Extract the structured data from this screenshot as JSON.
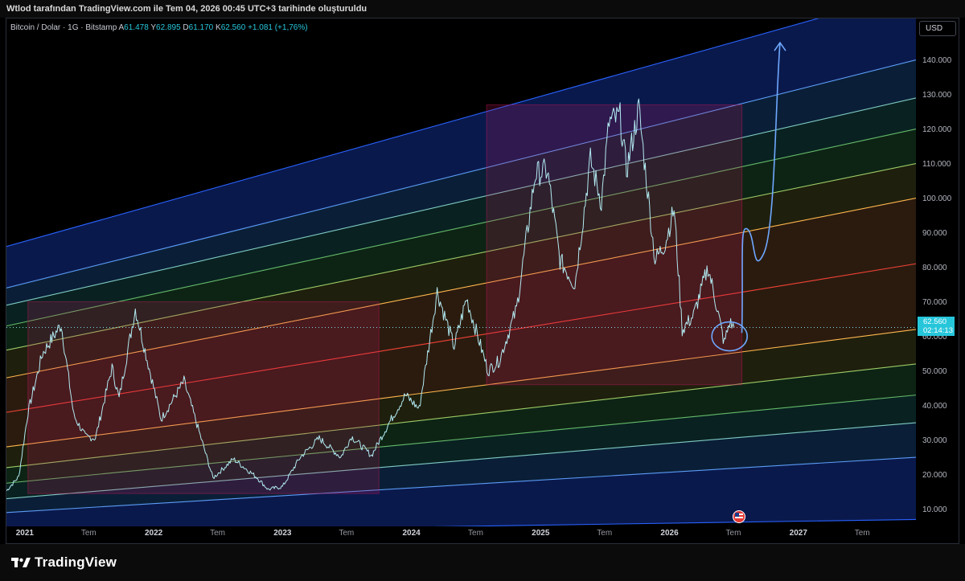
{
  "header": {
    "caption": "Wtlod tarafından TradingView.com ile Tem 04, 2026 00:45 UTC+3 tarihinde oluşturuldu"
  },
  "legend": {
    "symbol": "Bitcoin / Dolar · 1G · Bitstamp",
    "open_label": "A",
    "open": "61.478",
    "high_label": "Y",
    "high": "62.895",
    "low_label": "D",
    "low": "61.170",
    "close_label": "K",
    "close": "62.560",
    "change": "+1.081 (+1,76%)"
  },
  "currency": "USD",
  "price_tag": {
    "price": "62.560",
    "countdown": "02:14:13"
  },
  "brand": "TradingView",
  "colors": {
    "background": "#000000",
    "candle": "#b2ebf2",
    "accent": "#26c6da",
    "annotation": "#6ea8ff"
  },
  "chart_data": {
    "type": "candlestick",
    "x_axis": {
      "start": "2020-11-10",
      "end": "2027-11-30",
      "tick_labels": [
        {
          "date": "2021-01-01",
          "label": "2021"
        },
        {
          "date": "2021-07-01",
          "label": "Tem"
        },
        {
          "date": "2022-01-01",
          "label": "2022"
        },
        {
          "date": "2022-07-01",
          "label": "Tem"
        },
        {
          "date": "2023-01-01",
          "label": "2023"
        },
        {
          "date": "2023-07-01",
          "label": "Tem"
        },
        {
          "date": "2024-01-01",
          "label": "2024"
        },
        {
          "date": "2024-07-01",
          "label": "Tem"
        },
        {
          "date": "2025-01-01",
          "label": "2025"
        },
        {
          "date": "2025-07-01",
          "label": "Tem"
        },
        {
          "date": "2026-01-01",
          "label": "2026"
        },
        {
          "date": "2026-07-01",
          "label": "Tem"
        },
        {
          "date": "2027-01-01",
          "label": "2027"
        },
        {
          "date": "2027-07-01",
          "label": "Tem"
        }
      ]
    },
    "y_axis": {
      "range": [
        5000,
        152000
      ],
      "tick_labels": [
        "10.000",
        "20.000",
        "30.000",
        "40.000",
        "50.000",
        "60.000",
        "70.000",
        "80.000",
        "90.000",
        "100.000",
        "110.000",
        "120.000",
        "130.000",
        "140.000"
      ],
      "tick_values": [
        10000,
        20000,
        30000,
        40000,
        50000,
        60000,
        70000,
        80000,
        90000,
        100000,
        110000,
        120000,
        130000,
        140000
      ]
    },
    "price_series": [
      {
        "date": "2020-11-10",
        "price": 15300
      },
      {
        "date": "2020-12-15",
        "price": 19400
      },
      {
        "date": "2021-01-10",
        "price": 38000
      },
      {
        "date": "2021-02-20",
        "price": 55000
      },
      {
        "date": "2021-04-14",
        "price": 63500
      },
      {
        "date": "2021-05-20",
        "price": 37000
      },
      {
        "date": "2021-06-22",
        "price": 31000
      },
      {
        "date": "2021-07-20",
        "price": 30500
      },
      {
        "date": "2021-09-05",
        "price": 51000
      },
      {
        "date": "2021-09-25",
        "price": 42000
      },
      {
        "date": "2021-11-10",
        "price": 68000
      },
      {
        "date": "2022-01-22",
        "price": 36000
      },
      {
        "date": "2022-03-28",
        "price": 47000
      },
      {
        "date": "2022-06-18",
        "price": 19000
      },
      {
        "date": "2022-08-15",
        "price": 24500
      },
      {
        "date": "2022-10-20",
        "price": 19200
      },
      {
        "date": "2022-11-21",
        "price": 15700
      },
      {
        "date": "2023-01-01",
        "price": 16500
      },
      {
        "date": "2023-02-20",
        "price": 25000
      },
      {
        "date": "2023-04-15",
        "price": 30500
      },
      {
        "date": "2023-06-15",
        "price": 25000
      },
      {
        "date": "2023-07-15",
        "price": 31000
      },
      {
        "date": "2023-09-10",
        "price": 25500
      },
      {
        "date": "2023-10-30",
        "price": 35000
      },
      {
        "date": "2023-12-15",
        "price": 43000
      },
      {
        "date": "2024-01-23",
        "price": 39000
      },
      {
        "date": "2024-03-14",
        "price": 73000
      },
      {
        "date": "2024-05-01",
        "price": 57000
      },
      {
        "date": "2024-06-05",
        "price": 71000
      },
      {
        "date": "2024-08-05",
        "price": 50000
      },
      {
        "date": "2024-09-06",
        "price": 53000
      },
      {
        "date": "2024-10-25",
        "price": 68000
      },
      {
        "date": "2024-12-17",
        "price": 107000
      },
      {
        "date": "2025-01-20",
        "price": 108000
      },
      {
        "date": "2025-02-25",
        "price": 82000
      },
      {
        "date": "2025-04-08",
        "price": 75000
      },
      {
        "date": "2025-05-22",
        "price": 111000
      },
      {
        "date": "2025-06-22",
        "price": 99000
      },
      {
        "date": "2025-07-14",
        "price": 122000
      },
      {
        "date": "2025-08-14",
        "price": 123500
      },
      {
        "date": "2025-09-01",
        "price": 108000
      },
      {
        "date": "2025-10-06",
        "price": 126000
      },
      {
        "date": "2025-11-21",
        "price": 82000
      },
      {
        "date": "2025-12-20",
        "price": 87000
      },
      {
        "date": "2026-01-14",
        "price": 97000
      },
      {
        "date": "2026-02-06",
        "price": 62000
      },
      {
        "date": "2026-03-10",
        "price": 66000
      },
      {
        "date": "2026-04-20",
        "price": 80000
      },
      {
        "date": "2026-05-10",
        "price": 71000
      },
      {
        "date": "2026-06-05",
        "price": 58000
      },
      {
        "date": "2026-06-20",
        "price": 64000
      },
      {
        "date": "2026-07-03",
        "price": 62560
      }
    ],
    "regression_channel": {
      "anchor_start": "2020-11-10",
      "anchor_end": "2027-11-30",
      "lines": [
        {
          "start": 3000,
          "end": 7000,
          "color": "#2962ff"
        },
        {
          "start": 9000,
          "end": 25000,
          "color": "#5b9cf6"
        },
        {
          "start": 13000,
          "end": 35000,
          "color": "#80cbc4"
        },
        {
          "start": 17500,
          "end": 43000,
          "color": "#66bb6a"
        },
        {
          "start": 22000,
          "end": 52000,
          "color": "#9ccc65"
        },
        {
          "start": 28000,
          "end": 62000,
          "color": "#ffb74d"
        },
        {
          "start": 38000,
          "end": 81000,
          "color": "#f44336"
        },
        {
          "start": 48000,
          "end": 100000,
          "color": "#ffb74d"
        },
        {
          "start": 56000,
          "end": 110000,
          "color": "#9ccc65"
        },
        {
          "start": 63000,
          "end": 120000,
          "color": "#66bb6a"
        },
        {
          "start": 69000,
          "end": 129000,
          "color": "#80cbc4"
        },
        {
          "start": 74000,
          "end": 140000,
          "color": "#5b9cf6"
        },
        {
          "start": 86000,
          "end": 160000,
          "color": "#2962ff"
        }
      ]
    },
    "highlight_boxes": [
      {
        "start": "2021-01-10",
        "end": "2023-10-01",
        "low": 14500,
        "high": 70000
      },
      {
        "start": "2024-08-01",
        "end": "2026-07-25",
        "low": 46000,
        "high": 127000
      }
    ],
    "annotations": {
      "circle": {
        "date": "2026-06-20",
        "price": 60000
      },
      "projection_path": [
        {
          "date": "2026-07-25",
          "price": 61000
        },
        {
          "date": "2026-08-10",
          "price": 91000
        },
        {
          "date": "2026-09-25",
          "price": 84000
        },
        {
          "date": "2026-11-10",
          "price": 145000
        }
      ]
    },
    "current_price": 62560
  }
}
